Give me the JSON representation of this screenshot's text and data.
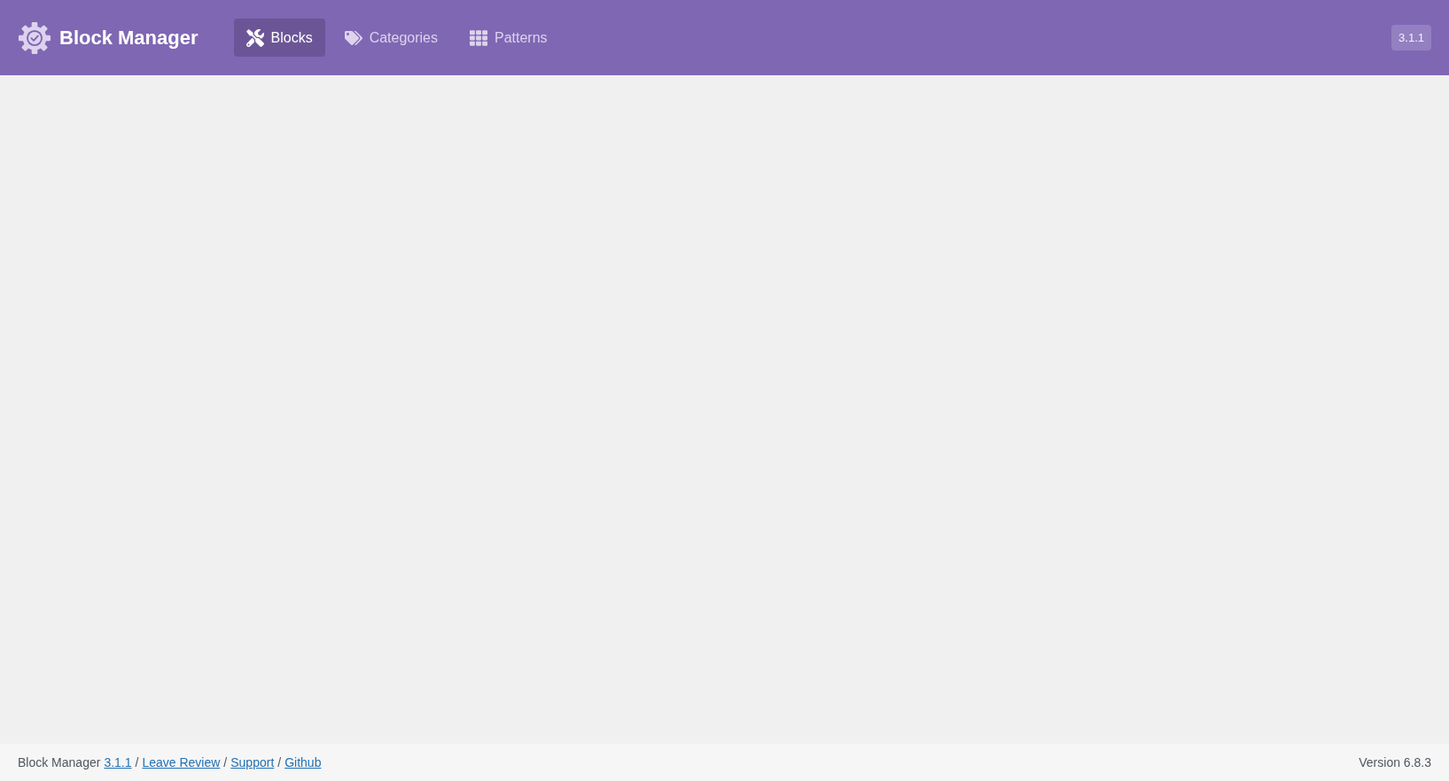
{
  "header": {
    "title": "Block Manager",
    "version": "3.1.1"
  },
  "tabs": [
    {
      "label": "Blocks",
      "kind": "tools",
      "selected": true
    },
    {
      "label": "Categories",
      "kind": "tags",
      "selected": false
    },
    {
      "label": "Patterns",
      "kind": "grid",
      "selected": false
    }
  ],
  "footer": {
    "items": [
      {
        "kind": "text",
        "text": "Block Manager"
      },
      {
        "kind": "link",
        "text": "3.1.1"
      },
      {
        "kind": "separator",
        "text": "/"
      },
      {
        "kind": "link",
        "text": "Leave Review"
      },
      {
        "kind": "separator",
        "text": "/"
      },
      {
        "kind": "link",
        "text": "Support"
      },
      {
        "kind": "separator",
        "text": "/"
      },
      {
        "kind": "link",
        "text": "Github"
      }
    ],
    "version": "Version 6.8.3"
  }
}
